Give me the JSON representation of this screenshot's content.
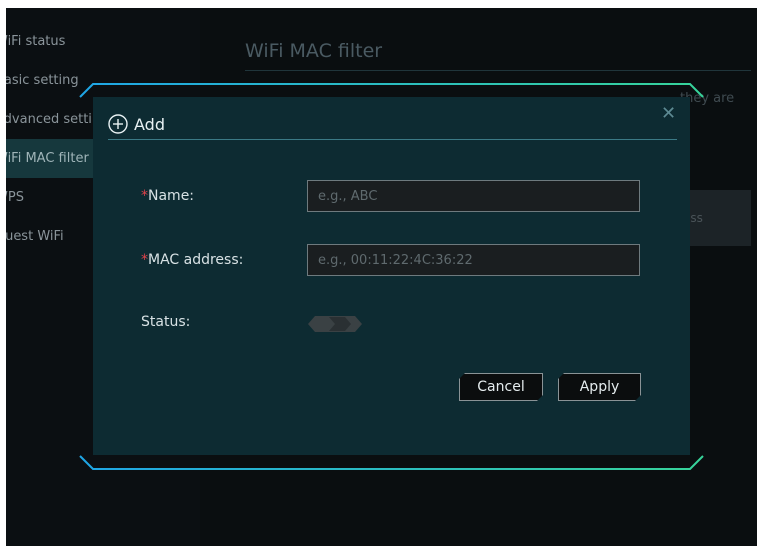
{
  "sidebar": {
    "items": [
      {
        "label": "WiFi status"
      },
      {
        "label": "Basic setting"
      },
      {
        "label": "Advanced setting"
      },
      {
        "label": "WiFi MAC filter"
      },
      {
        "label": "WPS"
      },
      {
        "label": "Guest WiFi"
      }
    ],
    "active_index": 3
  },
  "background": {
    "title": "WiFi MAC filter",
    "text_fragment": "they are",
    "bar_fragment": "ess"
  },
  "modal": {
    "title": "Add",
    "close_icon": "close-icon",
    "add_icon": "plus-circle-icon",
    "fields": {
      "name": {
        "required_mark": "*",
        "label": "Name:",
        "placeholder": "e.g., ABC",
        "value": ""
      },
      "mac": {
        "required_mark": "*",
        "label": "MAC address:",
        "placeholder": "e.g., 00:11:22:4C:36:22",
        "value": ""
      },
      "status": {
        "label": "Status:",
        "enabled": false
      }
    },
    "buttons": {
      "cancel": "Cancel",
      "apply": "Apply"
    }
  },
  "colors": {
    "accent_blue": "#1fa6e6",
    "accent_green": "#37d49a",
    "required": "#e0434b",
    "modal_bg": "#0d2b32"
  }
}
